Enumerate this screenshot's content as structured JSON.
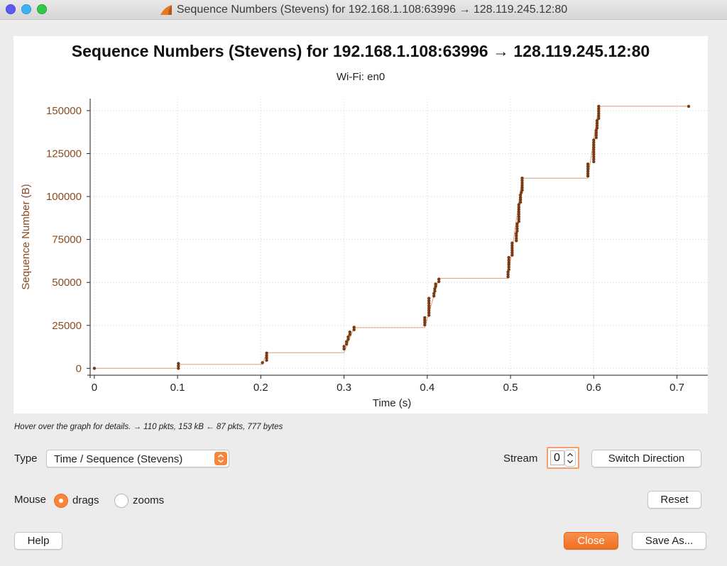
{
  "window": {
    "title": "Sequence Numbers (Stevens) for 192.168.1.108:63996 → 128.119.245.12:80"
  },
  "hint": "Hover over the graph for details. → 110 pkts, 153 kB ← 87 pkts, 777 bytes",
  "controls": {
    "type_label": "Type",
    "type_value": "Time / Sequence (Stevens)",
    "stream_label": "Stream",
    "stream_value": "0",
    "switch_direction": "Switch Direction",
    "mouse_label": "Mouse",
    "drags_label": "drags",
    "zooms_label": "zooms",
    "mouse_mode": "drags",
    "reset": "Reset",
    "help": "Help",
    "close": "Close",
    "save_as": "Save As..."
  },
  "colors": {
    "accent": "#f7853a",
    "data_point": "#7a3a12",
    "axis_text": "#8a4a1e"
  },
  "chart_data": {
    "type": "scatter",
    "title": "Sequence Numbers (Stevens) for 192.168.1.108:63996 → 128.119.245.12:80",
    "subtitle": "Wi-Fi: en0",
    "xlabel": "Time (s)",
    "ylabel": "Sequence Number (B)",
    "xlim": [
      -0.005,
      0.72
    ],
    "ylim": [
      -4000,
      157000
    ],
    "xticks": [
      "0",
      "0.1",
      "0.2",
      "0.3",
      "0.4",
      "0.5",
      "0.6",
      "0.7"
    ],
    "xtick_values": [
      0,
      0.1,
      0.2,
      0.3,
      0.4,
      0.5,
      0.6,
      0.7
    ],
    "yticks": [
      "0",
      "25000",
      "50000",
      "75000",
      "100000",
      "125000",
      "150000"
    ],
    "ytick_values": [
      0,
      25000,
      50000,
      75000,
      100000,
      125000,
      150000
    ],
    "grid": true,
    "series": [
      {
        "type": "scatter",
        "points": [
          [
            0.0,
            0
          ],
          [
            0.101,
            0
          ],
          [
            0.101,
            1400
          ],
          [
            0.101,
            2800
          ],
          [
            0.202,
            3300
          ],
          [
            0.207,
            4700
          ],
          [
            0.207,
            6100
          ],
          [
            0.207,
            7500
          ],
          [
            0.207,
            8900
          ],
          [
            0.3,
            11300
          ],
          [
            0.3,
            12700
          ],
          [
            0.303,
            14100
          ],
          [
            0.303,
            15500
          ],
          [
            0.305,
            16900
          ],
          [
            0.305,
            18300
          ],
          [
            0.307,
            19700
          ],
          [
            0.307,
            21100
          ],
          [
            0.312,
            22500
          ],
          [
            0.312,
            23900
          ],
          [
            0.397,
            25300
          ],
          [
            0.397,
            26700
          ],
          [
            0.397,
            28100
          ],
          [
            0.397,
            29500
          ],
          [
            0.402,
            30900
          ],
          [
            0.402,
            32300
          ],
          [
            0.402,
            33700
          ],
          [
            0.402,
            35100
          ],
          [
            0.402,
            36500
          ],
          [
            0.402,
            37900
          ],
          [
            0.402,
            39300
          ],
          [
            0.402,
            40700
          ],
          [
            0.408,
            42100
          ],
          [
            0.408,
            43500
          ],
          [
            0.409,
            44900
          ],
          [
            0.409,
            46300
          ],
          [
            0.41,
            47700
          ],
          [
            0.41,
            49100
          ],
          [
            0.414,
            50500
          ],
          [
            0.414,
            51900
          ],
          [
            0.497,
            53300
          ],
          [
            0.497,
            54700
          ],
          [
            0.497,
            56100
          ],
          [
            0.498,
            57500
          ],
          [
            0.498,
            58900
          ],
          [
            0.498,
            60300
          ],
          [
            0.498,
            61700
          ],
          [
            0.498,
            63100
          ],
          [
            0.498,
            64500
          ],
          [
            0.502,
            65900
          ],
          [
            0.502,
            67300
          ],
          [
            0.502,
            68700
          ],
          [
            0.502,
            70100
          ],
          [
            0.502,
            71500
          ],
          [
            0.502,
            72900
          ],
          [
            0.507,
            74300
          ],
          [
            0.507,
            75700
          ],
          [
            0.507,
            77100
          ],
          [
            0.507,
            78500
          ],
          [
            0.508,
            79900
          ],
          [
            0.508,
            81300
          ],
          [
            0.508,
            82700
          ],
          [
            0.508,
            84100
          ],
          [
            0.51,
            85500
          ],
          [
            0.51,
            86900
          ],
          [
            0.51,
            88300
          ],
          [
            0.51,
            89700
          ],
          [
            0.51,
            91100
          ],
          [
            0.51,
            92500
          ],
          [
            0.51,
            93900
          ],
          [
            0.51,
            95300
          ],
          [
            0.512,
            96700
          ],
          [
            0.512,
            98100
          ],
          [
            0.512,
            99500
          ],
          [
            0.512,
            100900
          ],
          [
            0.513,
            102300
          ],
          [
            0.514,
            103700
          ],
          [
            0.514,
            105100
          ],
          [
            0.514,
            106500
          ],
          [
            0.514,
            107900
          ],
          [
            0.514,
            109300
          ],
          [
            0.514,
            110700
          ],
          [
            0.593,
            111900
          ],
          [
            0.593,
            113300
          ],
          [
            0.593,
            114700
          ],
          [
            0.593,
            116100
          ],
          [
            0.593,
            117500
          ],
          [
            0.593,
            118900
          ],
          [
            0.6,
            120300
          ],
          [
            0.6,
            121700
          ],
          [
            0.6,
            123100
          ],
          [
            0.6,
            124500
          ],
          [
            0.6,
            125900
          ],
          [
            0.6,
            127300
          ],
          [
            0.6,
            128700
          ],
          [
            0.6,
            130100
          ],
          [
            0.6,
            131500
          ],
          [
            0.6,
            132900
          ],
          [
            0.603,
            134300
          ],
          [
            0.603,
            135700
          ],
          [
            0.603,
            137100
          ],
          [
            0.603,
            138500
          ],
          [
            0.604,
            139900
          ],
          [
            0.604,
            141300
          ],
          [
            0.604,
            142700
          ],
          [
            0.604,
            144100
          ],
          [
            0.606,
            145500
          ],
          [
            0.606,
            146900
          ],
          [
            0.606,
            148300
          ],
          [
            0.606,
            149700
          ],
          [
            0.606,
            151100
          ],
          [
            0.606,
            152500
          ],
          [
            0.714,
            152500
          ]
        ]
      },
      {
        "type": "line",
        "name": "",
        "points": [
          [
            0.0,
            0
          ],
          [
            0.101,
            0
          ],
          [
            0.101,
            2300
          ],
          [
            0.202,
            2300
          ],
          [
            0.207,
            9100
          ],
          [
            0.3,
            9100
          ],
          [
            0.312,
            23700
          ],
          [
            0.397,
            23700
          ],
          [
            0.414,
            52400
          ],
          [
            0.497,
            52400
          ],
          [
            0.514,
            110700
          ],
          [
            0.593,
            110700
          ],
          [
            0.606,
            152500
          ],
          [
            0.714,
            152500
          ]
        ]
      }
    ]
  }
}
